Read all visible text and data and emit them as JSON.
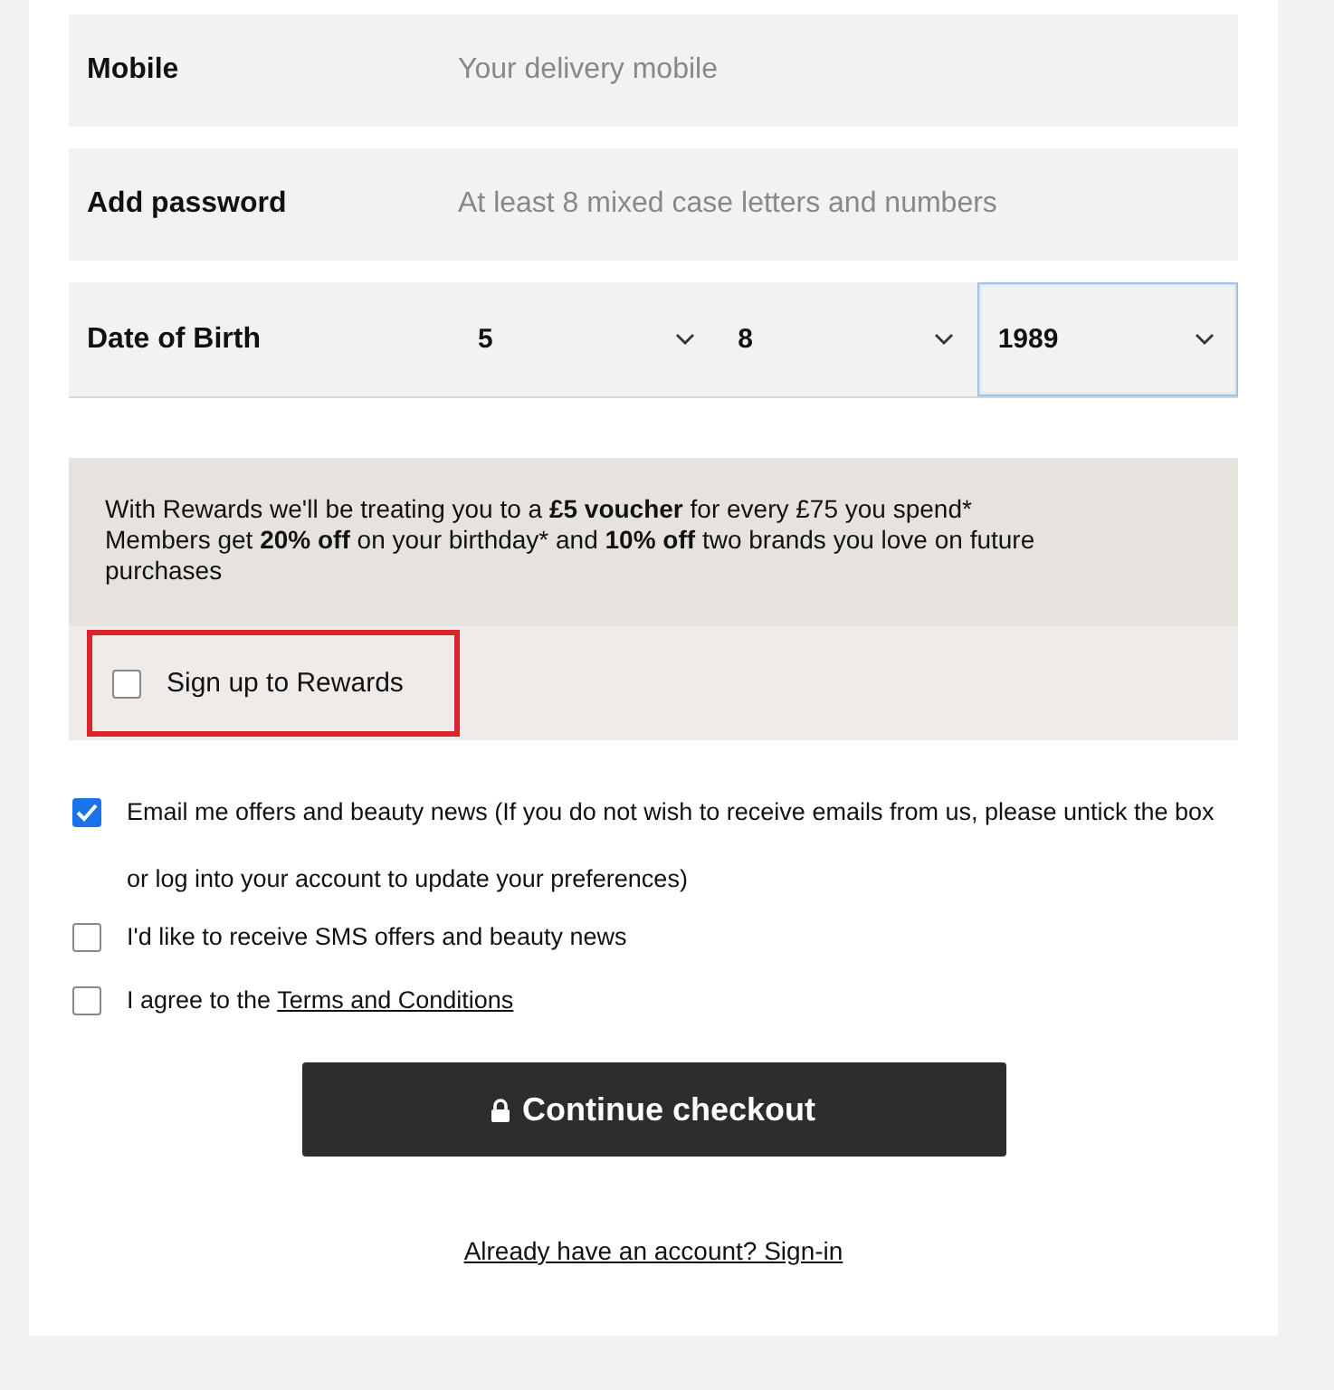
{
  "fields": [
    {
      "kind": "text",
      "label": "Mobile",
      "placeholder": "Your delivery mobile"
    },
    {
      "kind": "text",
      "label": "Add password",
      "placeholder": "At least 8 mixed case letters and numbers"
    },
    {
      "kind": "date",
      "label": "Date of Birth",
      "selects": [
        {
          "value": "5",
          "focused": false
        },
        {
          "value": "8",
          "focused": false
        },
        {
          "value": "1989",
          "focused": true
        }
      ]
    }
  ],
  "rewards": {
    "text": "With Rewards we'll be treating you to a **£5 voucher** for every £75 you spend*\nMembers get **20% off** on your birthday* and **10% off** two brands you love on future purchases",
    "checkbox": {
      "label": "Sign up to Rewards",
      "checked": false,
      "highlighted": true
    }
  },
  "consents": [
    {
      "label": "Email me offers and beauty news (If you do not wish to receive emails from us, please untick the box or log into your account to update your preferences)",
      "checked": true
    },
    {
      "label": "I'd like to receive SMS offers and beauty news",
      "checked": false
    },
    {
      "label": "I agree to the ",
      "link": "Terms and Conditions",
      "checked": false
    }
  ],
  "button": {
    "label": "Continue checkout"
  },
  "signin_link": "Already have an account? Sign-in"
}
